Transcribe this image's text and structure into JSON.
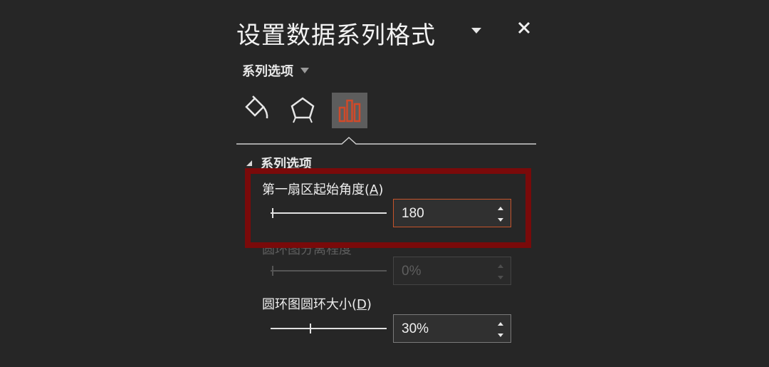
{
  "pane": {
    "title": "设置数据系列格式",
    "series_dropdown_label": "系列选项"
  },
  "tabs": [
    {
      "name": "fill-line",
      "icon": "paint-bucket-icon",
      "selected": false
    },
    {
      "name": "effects",
      "icon": "pentagon-icon",
      "selected": false
    },
    {
      "name": "series-options",
      "icon": "bar-chart-icon",
      "selected": true
    }
  ],
  "section": {
    "title": "系列选项",
    "expanded": true
  },
  "fields": {
    "first_slice_angle": {
      "label": "第一扇区起始角度",
      "accesskey": "A",
      "value": "180",
      "slider_fraction": 0.0,
      "enabled": true
    },
    "doughnut_explosion": {
      "label": "圆环图分离程度",
      "value": "0%",
      "slider_fraction": 0.0,
      "enabled": false
    },
    "doughnut_hole_size": {
      "label": "圆环图圆环大小",
      "accesskey": "D",
      "value": "30%",
      "slider_fraction": 0.33,
      "enabled": true
    }
  },
  "colors": {
    "background": "#262626",
    "accent_orange": "#c6532a",
    "chart_icon_orange": "#d04a2a",
    "highlight_red": "#7a0a0a"
  }
}
